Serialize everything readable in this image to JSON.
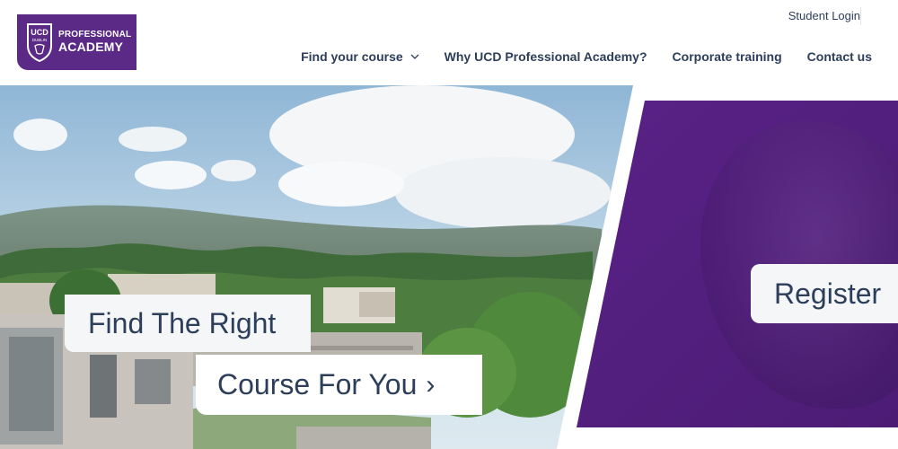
{
  "header": {
    "logo": {
      "line1": "PROFESSIONAL",
      "line2": "ACADEMY",
      "crest_text_top": "UCD",
      "crest_text_bottom": "DUBLIN",
      "bg_color": "#5b2a86"
    },
    "student_login": "Student Login",
    "nav": [
      {
        "label": "Find your course",
        "has_dropdown": true
      },
      {
        "label": "Why UCD Professional Academy?"
      },
      {
        "label": "Corporate training"
      },
      {
        "label": "Contact us"
      }
    ],
    "text_color": "#2c3e5a"
  },
  "hero": {
    "cta_line1": "Find The Right",
    "cta_line2": "Course For You",
    "cta_arrow": "›",
    "register_label": "Register",
    "accent_purple": "#5a2288"
  }
}
